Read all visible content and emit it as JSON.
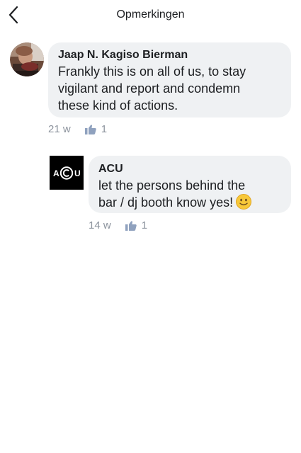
{
  "header": {
    "title": "Opmerkingen",
    "back_icon": "chevron-left-icon"
  },
  "comments": [
    {
      "author": "Jaap N. Kagiso Bierman",
      "text_lines": [
        "Frankly this is on all of us, to stay",
        "vigilant and report and condemn",
        "these kind of actions."
      ],
      "time": "21 w",
      "likes": "1",
      "avatar_icon": "profile-photo-avatar"
    },
    {
      "author": "ACU",
      "text_lines": [
        "let the persons behind the",
        "bar / dj booth know yes!"
      ],
      "emoji": "slightly-smiling-face-icon",
      "time": "14 w",
      "likes": "1",
      "avatar_logo_text": "ACU"
    }
  ],
  "colors": {
    "bubble": "#eff1f3",
    "meta": "#8d949e",
    "like": "#8fa1be"
  }
}
